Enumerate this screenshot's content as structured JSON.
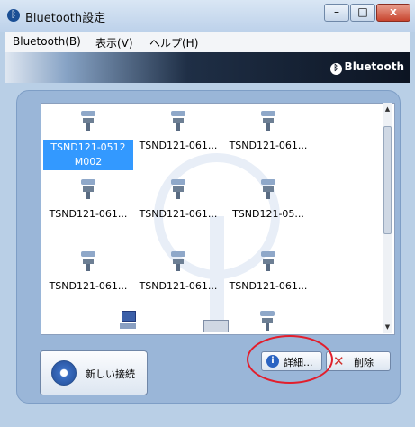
{
  "window": {
    "title": "Bluetooth設定",
    "close_glyph": "x"
  },
  "menu": {
    "items": [
      "Bluetooth(B)",
      "表示(V)",
      "ヘルプ(H)"
    ]
  },
  "banner": {
    "logo_text": "Bluetooth"
  },
  "devices": [
    {
      "label": "TSND121-0512",
      "label_line2": "M002",
      "selected": true
    },
    {
      "label": "TSND121-061..."
    },
    {
      "label": "TSND121-061..."
    },
    {
      "label": "TSND121-061..."
    },
    {
      "label": "TSND121-061..."
    },
    {
      "label": "TSND121-05..."
    },
    {
      "label": "TSND121-061..."
    },
    {
      "label": "TSND121-061..."
    },
    {
      "label": "TSND121-061..."
    }
  ],
  "buttons": {
    "new_connection": "新しい接続",
    "details": "詳細...",
    "delete": "削除"
  },
  "colors": {
    "selection": "#3399ff",
    "highlight_circle": "#e21e2c",
    "panel": "#9ab6d8"
  },
  "icons": {
    "title": "bluetooth-icon",
    "details": "info-icon",
    "delete": "x-icon",
    "new": "wireless-signal-icon"
  }
}
